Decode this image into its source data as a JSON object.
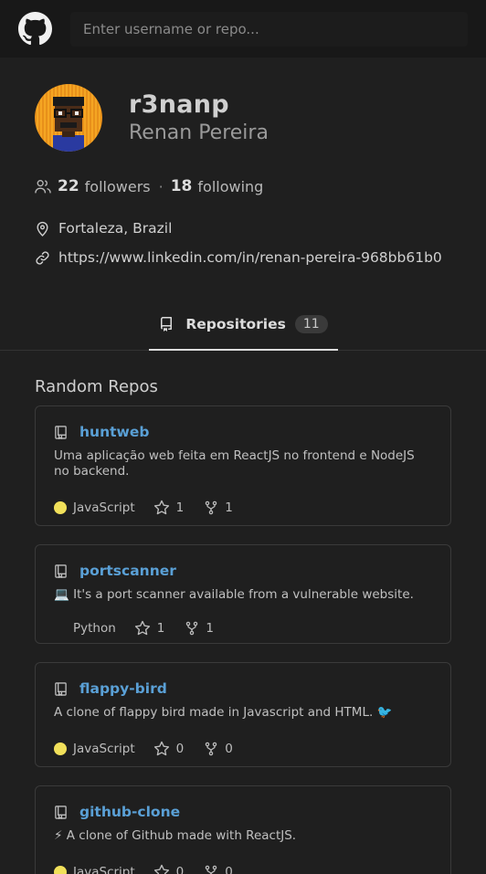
{
  "search": {
    "placeholder": "Enter username or repo..."
  },
  "profile": {
    "login": "r3nanp",
    "full_name": "Renan Pereira",
    "followers_count": "22",
    "followers_label": "followers",
    "separator": "·",
    "following_count": "18",
    "following_label": "following",
    "location": "Fortaleza, Brazil",
    "website": "https://www.linkedin.com/in/renan-pereira-968bb61b0"
  },
  "tabs": [
    {
      "label": "Repositories",
      "count": "11"
    }
  ],
  "random_repos_title": "Random Repos",
  "repos": [
    {
      "name": "huntweb",
      "description": "Uma aplicação web feita em ReactJS no frontend e NodeJS no backend.",
      "language": "JavaScript",
      "language_color": "#f1e05a",
      "stars": "1",
      "forks": "1"
    },
    {
      "name": "portscanner",
      "description": "💻 It's a port scanner available from a vulnerable website.",
      "language": "Python",
      "language_color": "",
      "stars": "1",
      "forks": "1"
    },
    {
      "name": "flappy-bird",
      "description": "A clone of flappy bird made in Javascript and HTML. 🐦",
      "language": "JavaScript",
      "language_color": "#f1e05a",
      "stars": "0",
      "forks": "0"
    },
    {
      "name": "github-clone",
      "description": "⚡ A clone of Github made with ReactJS.",
      "language": "JavaScript",
      "language_color": "#f1e05a",
      "stars": "0",
      "forks": "0"
    }
  ],
  "colors": {
    "link_blue": "#5aa0d6",
    "javascript": "#f1e05a",
    "avatar_bg": "#f5a623"
  }
}
